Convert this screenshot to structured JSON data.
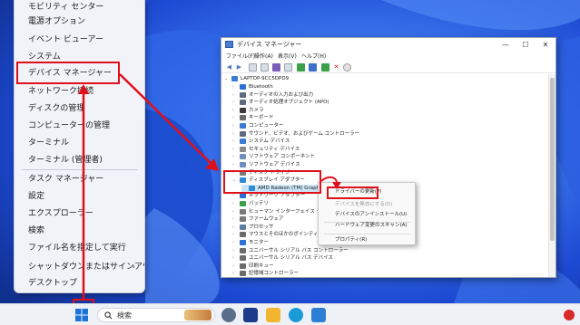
{
  "winx_menu": {
    "items": [
      {
        "label": "モビリティ センター",
        "has_submenu": false
      },
      {
        "label": "電源オプション",
        "has_submenu": false
      },
      {
        "label": "イベント ビューアー",
        "has_submenu": false
      },
      {
        "label": "システム",
        "has_submenu": false
      },
      {
        "label": "デバイス マネージャー",
        "has_submenu": false,
        "highlighted": true
      },
      {
        "label": "ネットワーク接続",
        "has_submenu": false
      },
      {
        "label": "ディスクの管理",
        "has_submenu": false
      },
      {
        "label": "コンピューターの管理",
        "has_submenu": false
      },
      {
        "label": "ターミナル",
        "has_submenu": false
      },
      {
        "label": "ターミナル (管理者)",
        "has_submenu": false
      },
      {
        "label": "タスク マネージャー",
        "has_submenu": false
      },
      {
        "label": "設定",
        "has_submenu": false
      },
      {
        "label": "エクスプローラー",
        "has_submenu": false
      },
      {
        "label": "検索",
        "has_submenu": false
      },
      {
        "label": "ファイル名を指定して実行",
        "has_submenu": false
      },
      {
        "label": "シャットダウンまたはサインアウト",
        "has_submenu": true
      },
      {
        "label": "デスクトップ",
        "has_submenu": false
      }
    ],
    "submenu_arrow": "›"
  },
  "device_manager": {
    "title": "デバイス マネージャー",
    "window_buttons": {
      "minimize": "—",
      "maximize": "☐",
      "close": "✕"
    },
    "menu": [
      "ファイル(F)",
      "操作(A)",
      "表示(V)",
      "ヘルプ(H)"
    ],
    "toolbar_icons": [
      "back-icon",
      "forward-icon",
      "properties-icon",
      "help-icon",
      "show-hidden-icon",
      "scan-icon",
      "update-driver-icon",
      "disable-icon",
      "uninstall-icon",
      "download-icon"
    ],
    "root": "LAPTOP-9CC5DPD9",
    "tree": [
      {
        "label": "Bluetooth",
        "color": "#2a6fd6",
        "expanded": false
      },
      {
        "label": "オーディオの入力および出力",
        "color": "#5c6b80",
        "expanded": false
      },
      {
        "label": "オーディオ処理オブジェクト (APO)",
        "color": "#5c6b80",
        "expanded": false
      },
      {
        "label": "カメラ",
        "color": "#3a3a3a",
        "expanded": false
      },
      {
        "label": "キーボード",
        "color": "#6b6b6b",
        "expanded": false
      },
      {
        "label": "コンピューター",
        "color": "#3b7bd4",
        "expanded": false
      },
      {
        "label": "サウンド、ビデオ、およびゲーム コントローラー",
        "color": "#5c6b80",
        "expanded": false
      },
      {
        "label": "システム デバイス",
        "color": "#3b7bd4",
        "expanded": false
      },
      {
        "label": "セキュリティ デバイス",
        "color": "#8a8a8a",
        "expanded": false
      },
      {
        "label": "ソフトウェア コンポーネント",
        "color": "#6b8fbf",
        "expanded": false
      },
      {
        "label": "ソフトウェア デバイス",
        "color": "#6b8fbf",
        "expanded": false
      },
      {
        "label": "ディスク ドライブ",
        "color": "#7a7a7a",
        "expanded": false
      },
      {
        "label": "ディスプレイ アダプター",
        "color": "#2e8bd6",
        "expanded": true
      },
      {
        "label": "AMD Radeon (TM) Graphics",
        "color": "#2e8bd6",
        "child": true,
        "selected": true
      },
      {
        "label": "ネットワーク アダプター",
        "color": "#2a6fd6",
        "expanded": false
      },
      {
        "label": "バッテリ",
        "color": "#3aa04a",
        "expanded": false
      },
      {
        "label": "ヒューマン インターフェイス デバイス",
        "color": "#7a7a7a",
        "expanded": false
      },
      {
        "label": "ファームウェア",
        "color": "#7a7a7a",
        "expanded": false
      },
      {
        "label": "プロセッサ",
        "color": "#5b7fa6",
        "expanded": false
      },
      {
        "label": "マウスとそのほかのポインティング デバイス",
        "color": "#6b6b6b",
        "expanded": false
      },
      {
        "label": "モニター",
        "color": "#2a6fd6",
        "expanded": false
      },
      {
        "label": "ユニバーサル シリアル バス コントローラー",
        "color": "#6b6b6b",
        "expanded": false
      },
      {
        "label": "ユニバーサル シリアル バス デバイス",
        "color": "#6b6b6b",
        "expanded": false
      },
      {
        "label": "印刷キュー",
        "color": "#6b6b6b",
        "expanded": false
      },
      {
        "label": "記憶域コントローラー",
        "color": "#6b6b6b",
        "expanded": false
      }
    ]
  },
  "context_menu": {
    "items": [
      "ドライバーの更新(P)",
      "デバイスを無効にする(D)",
      "デバイスのアンインストール(U)",
      "ハードウェア変更のスキャン(A)",
      "プロパティ(R)"
    ]
  },
  "taskbar": {
    "search_label": "検索",
    "apps": [
      {
        "name": "widgets-icon",
        "color": "#c98a3a"
      },
      {
        "name": "settings-icon",
        "color": "#5b6f8a"
      },
      {
        "name": "store-icon",
        "color": "#1e4fa8"
      },
      {
        "name": "explorer-icon",
        "color": "#f2b630"
      },
      {
        "name": "edge-icon",
        "color": "#1a9bd7"
      },
      {
        "name": "photos-icon",
        "color": "#2d7fd6"
      }
    ]
  },
  "colors": {
    "annotation_red": "#e0101a",
    "wallpaper_blue": "#1d4fd8",
    "selection_blue": "#cce4f7"
  }
}
